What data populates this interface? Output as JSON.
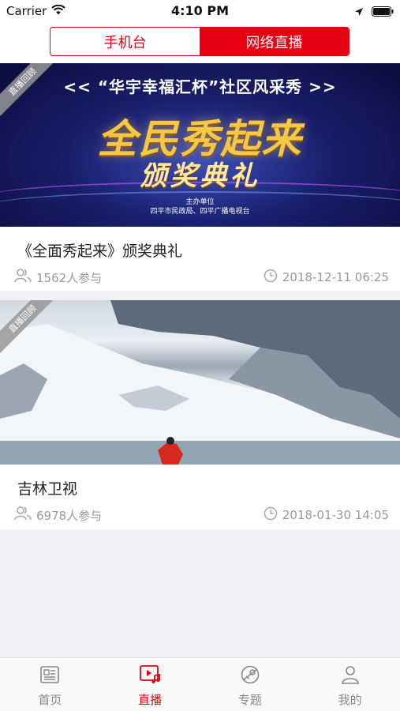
{
  "status_bar": {
    "carrier": "Carrier",
    "time": "4:10 PM"
  },
  "header": {
    "tabs": [
      {
        "label": "手机台",
        "active": false
      },
      {
        "label": "网络直播",
        "active": true
      }
    ]
  },
  "feed": [
    {
      "badge": "直播回顾",
      "banner": {
        "top_text": "<< “华宇幸福汇杯”社区风采秀 >>",
        "main_text": "全民秀起来",
        "sub_text": "颁奖典礼",
        "org_title": "主办单位",
        "org_line": "四平市民政局、四平广播电视台"
      },
      "title": "《全面秀起来》颁奖典礼",
      "participants": "1562人参与",
      "datetime": "2018-12-11 06:25"
    },
    {
      "badge": "直播回顾",
      "title": "吉林卫视",
      "participants": "6978人参与",
      "datetime": "2018-01-30 14:05"
    }
  ],
  "tabbar": {
    "items": [
      {
        "label": "首页",
        "icon": "news-icon"
      },
      {
        "label": "直播",
        "icon": "live-video-icon",
        "active": true
      },
      {
        "label": "专题",
        "icon": "topic-icon"
      },
      {
        "label": "我的",
        "icon": "profile-icon"
      }
    ]
  },
  "colors": {
    "accent": "#e60012",
    "text": "#222222",
    "muted": "#999999",
    "background": "#f1f2f6"
  }
}
